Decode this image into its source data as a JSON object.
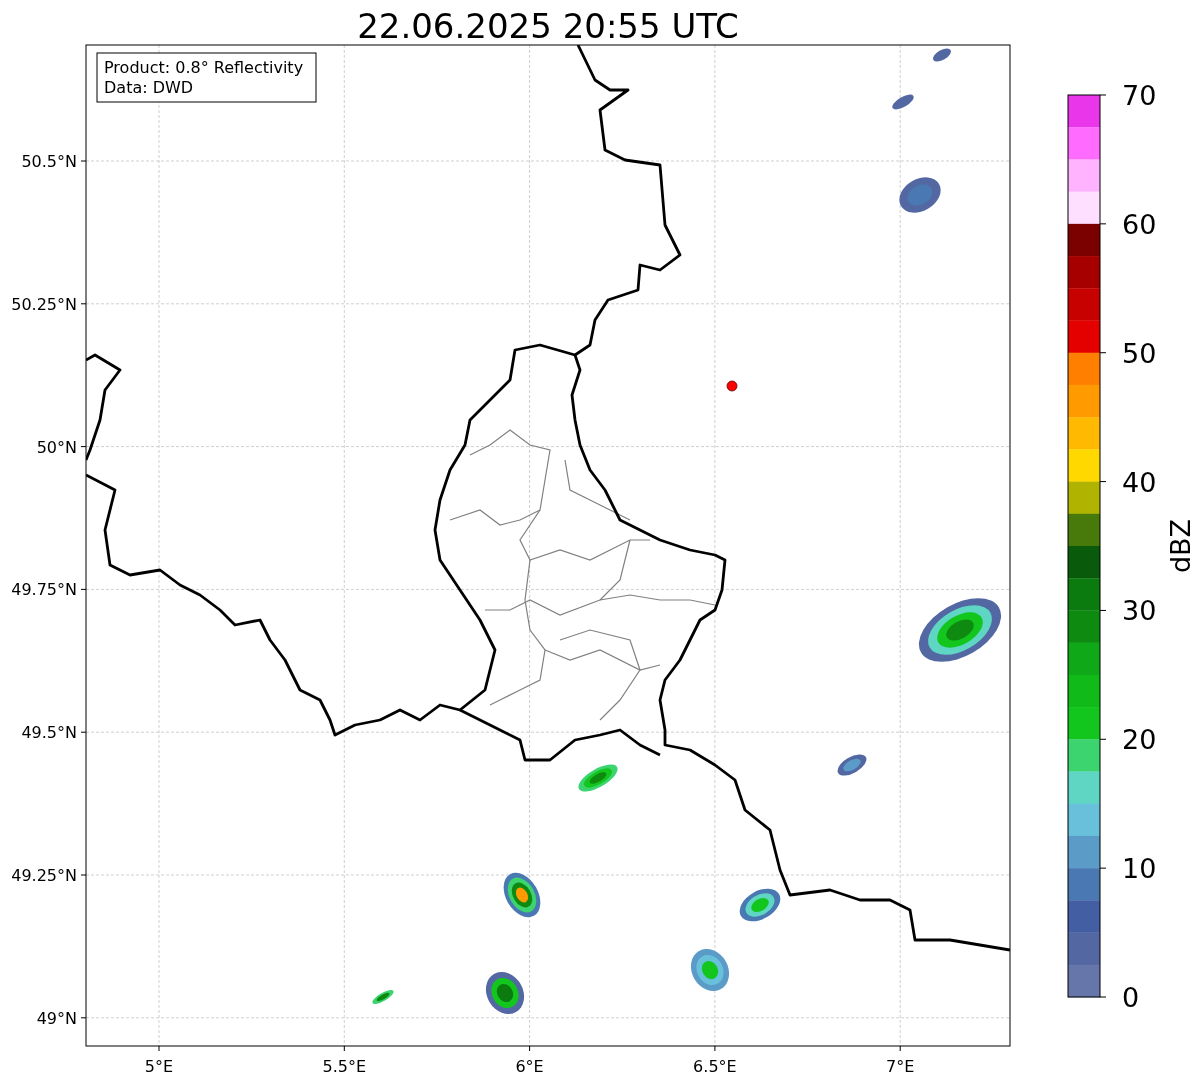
{
  "title": "22.06.2025 20:55 UTC",
  "map": {
    "info_box": [
      "Product: 0.8° Reflectivity",
      "Data: DWD"
    ],
    "xticks": [
      "5°E",
      "5.5°E",
      "6°E",
      "6.5°E",
      "7°E"
    ],
    "yticks": [
      "50.5°N",
      "50.25°N",
      "50°N",
      "49.75°N",
      "49.5°N",
      "49.25°N",
      "49°N"
    ]
  },
  "colorbar": {
    "label": "dBZ",
    "ticks": [
      "70",
      "60",
      "50",
      "40",
      "30",
      "20",
      "10",
      "0"
    ],
    "bands": [
      {
        "color": "#ea36ea"
      },
      {
        "color": "#ff6bff"
      },
      {
        "color": "#ffb3ff"
      },
      {
        "color": "#ffdfff"
      },
      {
        "color": "#7b0000"
      },
      {
        "color": "#a70000"
      },
      {
        "color": "#c70000"
      },
      {
        "color": "#e50000"
      },
      {
        "color": "#ff7f00"
      },
      {
        "color": "#ff9a00"
      },
      {
        "color": "#ffb900"
      },
      {
        "color": "#ffd800"
      },
      {
        "color": "#b0b400"
      },
      {
        "color": "#477a0b"
      },
      {
        "color": "#095a0a"
      },
      {
        "color": "#0b7b0f"
      },
      {
        "color": "#0e8a10"
      },
      {
        "color": "#0fa818"
      },
      {
        "color": "#10ba18"
      },
      {
        "color": "#12c61d"
      },
      {
        "color": "#3bd46f"
      },
      {
        "color": "#5fd6c4"
      },
      {
        "color": "#68c0db"
      },
      {
        "color": "#5b9bc7"
      },
      {
        "color": "#4a78b3"
      },
      {
        "color": "#445ea3"
      },
      {
        "color": "#5368a3"
      },
      {
        "color": "#6676aa"
      }
    ]
  }
}
